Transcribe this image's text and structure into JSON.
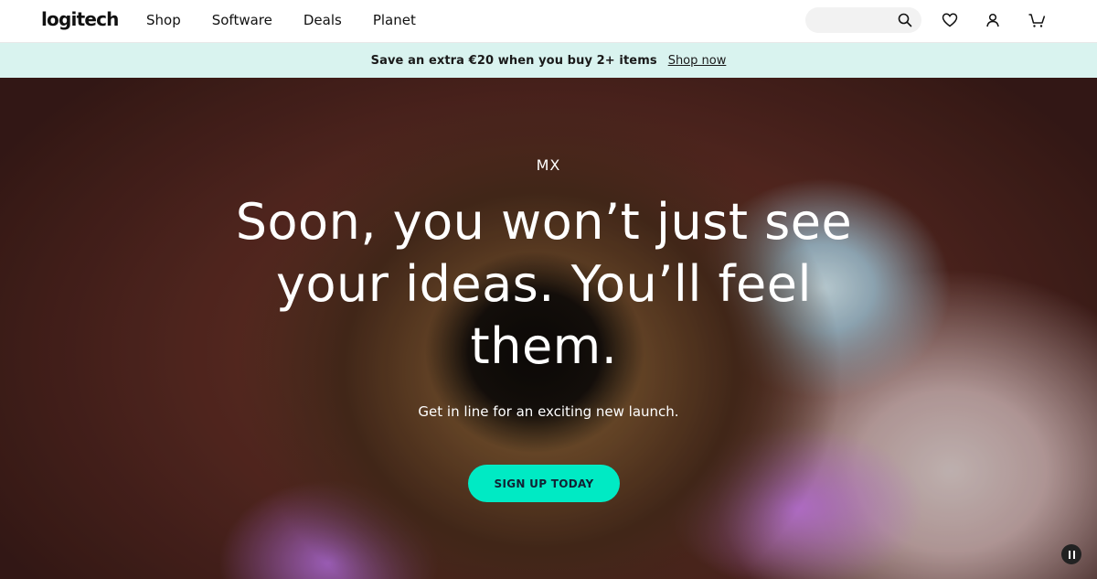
{
  "header": {
    "logo": "logitech",
    "nav": [
      "Shop",
      "Software",
      "Deals",
      "Planet"
    ],
    "search_placeholder": "",
    "icons": [
      "search-icon",
      "heart-icon",
      "user-icon",
      "cart-icon"
    ]
  },
  "promo": {
    "text": "Save an extra €20 when you buy 2+ items",
    "link": "Shop now",
    "background": "#d9f3ef"
  },
  "hero": {
    "eyebrow": "MX",
    "headline": "Soon, you won’t just see your ideas. You’ll feel them.",
    "subtext": "Get in line for an exciting new launch.",
    "cta": "SIGN UP TODAY",
    "cta_color": "#00eac4",
    "media_control": "pause-icon"
  }
}
